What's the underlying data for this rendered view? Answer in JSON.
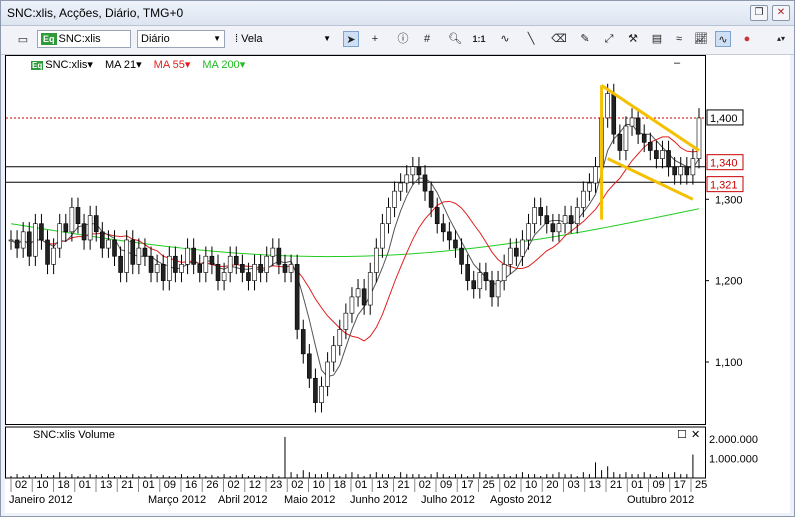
{
  "window": {
    "title": "SNC:xlis, Acções, Diário, TMG+0",
    "buttons": [
      "restore",
      "close"
    ]
  },
  "toolbar": {
    "symbol": "SNC:xlis",
    "period": "Diário",
    "chart_type": "Vela",
    "tools": [
      "cursor-arrow",
      "crosshair",
      "info",
      "grid",
      "zoom",
      "one-to-one",
      "indicator",
      "trendline",
      "eraser",
      "pen",
      "arrows",
      "tools",
      "sheet",
      "wave",
      "chart",
      "wave-active"
    ]
  },
  "legend": {
    "symbol": "SNC:xlis",
    "ma21": "MA 21",
    "ma55": "MA 55",
    "ma200": "MA 200",
    "colors": {
      "ma21": "#555555",
      "ma55": "#e02020",
      "ma200": "#22cc22",
      "candle_up": "#ffffff",
      "candle_down": "#222222",
      "pattern": "#f5c000",
      "level_dotted": "#cc0000"
    }
  },
  "price_axis": {
    "ticks": [
      "1,300",
      "1,200",
      "1,100"
    ],
    "current": "1,400",
    "level1": "1,340",
    "level2": "1,321"
  },
  "volume_pane": {
    "label": "SNC:xlis Volume",
    "ticks": [
      "2.000.000",
      "1.000.000"
    ]
  },
  "time_axis": {
    "days": [
      "02",
      "10",
      "18",
      "01",
      "13",
      "21",
      "01",
      "09",
      "16",
      "26",
      "02",
      "12",
      "23",
      "02",
      "10",
      "18",
      "01",
      "13",
      "21",
      "02",
      "09",
      "17",
      "25",
      "02",
      "10",
      "20",
      "03",
      "13",
      "21",
      "01",
      "09",
      "17",
      "25"
    ],
    "months": [
      "Janeiro 2012",
      "Março 2012",
      "Abril 2012",
      "Maio 2012",
      "Junho 2012",
      "Julho 2012",
      "Agosto 2012",
      "Outubro 2012"
    ]
  },
  "chart_data": {
    "type": "candlestick",
    "title": "SNC:xlis, Acções, Diário",
    "y_range": [
      1.025,
      1.47
    ],
    "horizontal_levels": [
      1.4,
      1.34,
      1.321
    ],
    "close_series": [
      1.25,
      1.24,
      1.26,
      1.23,
      1.27,
      1.25,
      1.22,
      1.24,
      1.27,
      1.26,
      1.29,
      1.27,
      1.25,
      1.28,
      1.26,
      1.24,
      1.25,
      1.23,
      1.21,
      1.25,
      1.22,
      1.24,
      1.23,
      1.21,
      1.22,
      1.2,
      1.23,
      1.21,
      1.22,
      1.24,
      1.22,
      1.21,
      1.23,
      1.22,
      1.2,
      1.21,
      1.23,
      1.22,
      1.21,
      1.2,
      1.22,
      1.21,
      1.23,
      1.24,
      1.22,
      1.21,
      1.22,
      1.14,
      1.11,
      1.08,
      1.05,
      1.07,
      1.1,
      1.12,
      1.14,
      1.16,
      1.18,
      1.19,
      1.17,
      1.21,
      1.24,
      1.27,
      1.29,
      1.31,
      1.32,
      1.33,
      1.34,
      1.33,
      1.31,
      1.29,
      1.27,
      1.26,
      1.25,
      1.24,
      1.22,
      1.2,
      1.19,
      1.21,
      1.2,
      1.18,
      1.2,
      1.22,
      1.24,
      1.23,
      1.25,
      1.27,
      1.29,
      1.28,
      1.27,
      1.26,
      1.27,
      1.28,
      1.27,
      1.29,
      1.31,
      1.32,
      1.34,
      1.4,
      1.43,
      1.38,
      1.36,
      1.39,
      1.4,
      1.38,
      1.37,
      1.36,
      1.35,
      1.36,
      1.34,
      1.33,
      1.34,
      1.33,
      1.35,
      1.4
    ],
    "volume_series": [
      0.1,
      0.2,
      0.1,
      0.15,
      0.1,
      0.2,
      0.1,
      0.15,
      0.3,
      0.1,
      0.2,
      0.1,
      0.1,
      0.2,
      0.15,
      0.1,
      0.2,
      0.1,
      0.15,
      0.1,
      0.2,
      0.1,
      0.1,
      0.2,
      0.1,
      0.15,
      0.1,
      0.1,
      0.2,
      0.1,
      0.1,
      0.2,
      0.1,
      0.15,
      0.1,
      0.2,
      0.1,
      0.15,
      0.2,
      0.1,
      0.15,
      0.1,
      0.1,
      0.2,
      0.1,
      2.1,
      0.3,
      0.2,
      0.4,
      0.3,
      0.2,
      0.2,
      0.3,
      0.2,
      0.1,
      0.2,
      0.3,
      0.2,
      0.1,
      0.2,
      0.3,
      0.2,
      0.2,
      0.1,
      0.3,
      0.2,
      0.2,
      0.2,
      0.1,
      0.2,
      0.3,
      0.2,
      0.1,
      0.2,
      0.2,
      0.1,
      0.2,
      0.3,
      0.2,
      0.1,
      0.2,
      0.2,
      0.1,
      0.2,
      0.3,
      0.2,
      0.2,
      0.1,
      0.2,
      0.2,
      0.3,
      0.2,
      0.2,
      0.1,
      0.3,
      0.2,
      0.8,
      0.4,
      0.6,
      0.3,
      0.2,
      0.3,
      0.2,
      0.2,
      0.3,
      0.2,
      0.1,
      0.3,
      0.2,
      0.3,
      0.2,
      0.2,
      1.2
    ]
  }
}
